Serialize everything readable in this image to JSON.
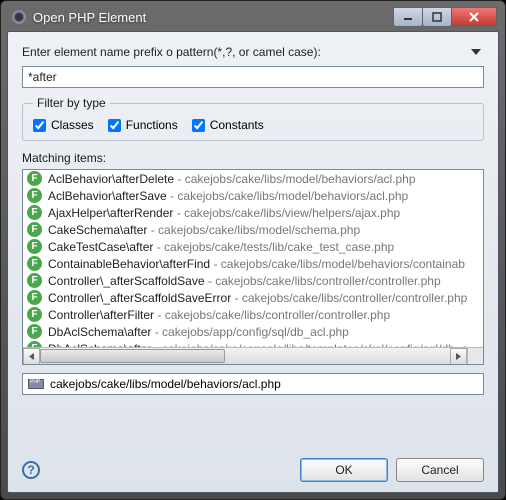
{
  "window": {
    "title": "Open PHP Element"
  },
  "prompt": "Enter element name prefix o pattern(*,?, or camel case):",
  "search": {
    "value": "*after"
  },
  "filter": {
    "legend": "Filter by type",
    "classes": {
      "label": "Classes",
      "checked": true
    },
    "functions": {
      "label": "Functions",
      "checked": true
    },
    "constants": {
      "label": "Constants",
      "checked": true
    }
  },
  "matching_label": "Matching items:",
  "results": [
    {
      "kind": "F",
      "name": "AclBehavior\\afterDelete",
      "path": "cakejobs/cake/libs/model/behaviors/acl.php"
    },
    {
      "kind": "F",
      "name": "AclBehavior\\afterSave",
      "path": "cakejobs/cake/libs/model/behaviors/acl.php"
    },
    {
      "kind": "F",
      "name": "AjaxHelper\\afterRender",
      "path": "cakejobs/cake/libs/view/helpers/ajax.php"
    },
    {
      "kind": "F",
      "name": "CakeSchema\\after",
      "path": "cakejobs/cake/libs/model/schema.php"
    },
    {
      "kind": "F",
      "name": "CakeTestCase\\after",
      "path": "cakejobs/cake/tests/lib/cake_test_case.php"
    },
    {
      "kind": "F",
      "name": "ContainableBehavior\\afterFind",
      "path": "cakejobs/cake/libs/model/behaviors/containab"
    },
    {
      "kind": "F",
      "name": "Controller\\_afterScaffoldSave",
      "path": "cakejobs/cake/libs/controller/controller.php"
    },
    {
      "kind": "F",
      "name": "Controller\\_afterScaffoldSaveError",
      "path": "cakejobs/cake/libs/controller/controller.php"
    },
    {
      "kind": "F",
      "name": "Controller\\afterFilter",
      "path": "cakejobs/cake/libs/controller/controller.php"
    },
    {
      "kind": "F",
      "name": "DbAclSchema\\after",
      "path": "cakejobs/app/config/sql/db_acl.php"
    },
    {
      "kind": "F",
      "name": "DbAclSchema\\after",
      "path": "cakejobs/cake/console/libs/templates/skel/config/sql/db_a"
    }
  ],
  "selected_path": "cakejobs/cake/libs/model/behaviors/acl.php",
  "buttons": {
    "ok": "OK",
    "cancel": "Cancel"
  }
}
